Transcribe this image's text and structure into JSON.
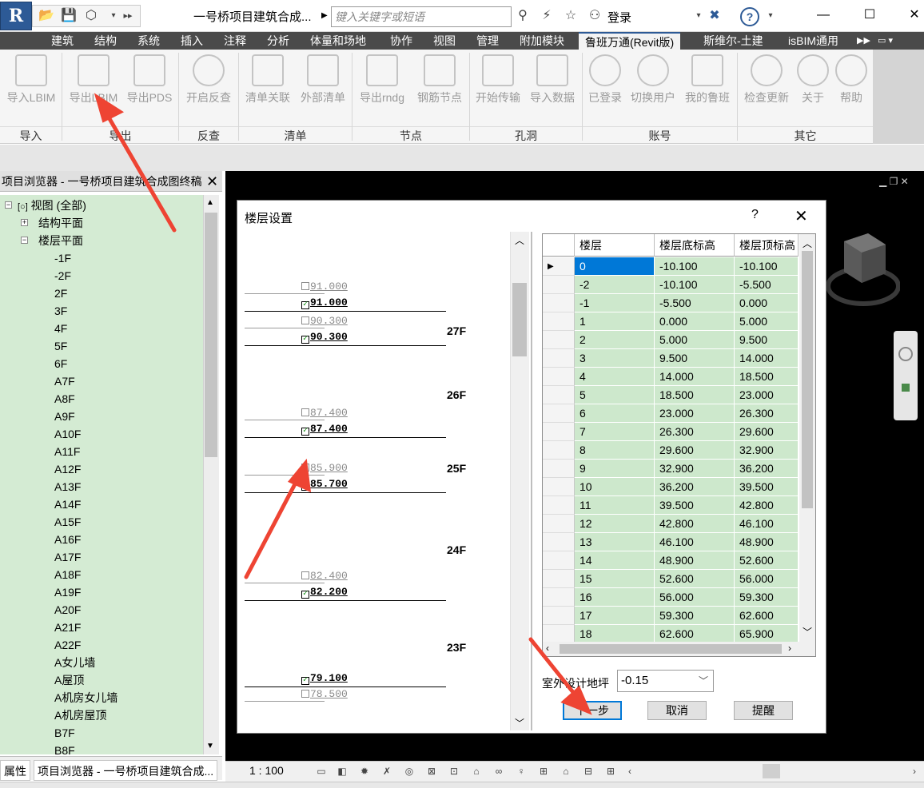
{
  "titlebar": {
    "app_glyph": "R",
    "document_title": "一号桥项目建筑合成...",
    "search_placeholder": "键入关键字或短语",
    "login_label": "登录",
    "help_glyph": "?",
    "minimize_glyph": "—",
    "maximize_glyph": "☐",
    "close_glyph": "✕"
  },
  "menu": {
    "items": [
      "建筑",
      "结构",
      "系统",
      "插入",
      "注释",
      "分析",
      "体量和场地",
      "协作",
      "视图",
      "管理",
      "附加模块",
      "鲁班万通(Revit版)",
      "斯维尔-土建",
      "isBIM通用"
    ],
    "active_index": 11
  },
  "ribbon": {
    "buttons": [
      "导入LBIM",
      "导出LBIM",
      "导出PDS",
      "开启反查",
      "清单关联",
      "外部清单",
      "导出rndg",
      "钢筋节点",
      "开始传输",
      "导入数据",
      "已登录",
      "切换用户",
      "我的鲁班",
      "检查更新",
      "关于",
      "帮助"
    ],
    "groups": [
      "导入",
      "导出",
      "反查",
      "清单",
      "节点",
      "孔洞",
      "账号",
      "其它"
    ]
  },
  "project_browser": {
    "title": "项目浏览器 - 一号桥项目建筑合成图终稿",
    "root": "视图 (全部)",
    "structural_plan": "结构平面",
    "floor_plan": "楼层平面",
    "floors": [
      "-1F",
      "-2F",
      "2F",
      "3F",
      "4F",
      "5F",
      "6F",
      "A7F",
      "A8F",
      "A9F",
      "A10F",
      "A11F",
      "A12F",
      "A13F",
      "A14F",
      "A15F",
      "A16F",
      "A17F",
      "A18F",
      "A19F",
      "A20F",
      "A21F",
      "A22F",
      "A女儿墙",
      "A屋顶",
      "A机房女儿墙",
      "A机房屋顶",
      "B7F",
      "B8F"
    ],
    "tabs": [
      "属性",
      "项目浏览器 - 一号桥项目建筑合成..."
    ]
  },
  "view": {
    "scale": "1 : 100"
  },
  "dialog": {
    "title": "楼层设置",
    "help": "?",
    "close": "✕",
    "elevations": [
      {
        "value": "91.000",
        "checked": false
      },
      {
        "value": "91.000",
        "checked": true
      },
      {
        "value": "90.300",
        "checked": false
      },
      {
        "value": "90.300",
        "checked": true
      },
      {
        "value": "87.400",
        "checked": false
      },
      {
        "value": "87.400",
        "checked": true
      },
      {
        "value": "85.900",
        "checked": false
      },
      {
        "value": "85.700",
        "checked": true
      },
      {
        "value": "82.400",
        "checked": false
      },
      {
        "value": "82.200",
        "checked": true
      },
      {
        "value": "79.100",
        "checked": true
      },
      {
        "value": "78.500",
        "checked": false
      }
    ],
    "floor_labels": [
      "27F",
      "26F",
      "25F",
      "24F",
      "23F"
    ],
    "grid": {
      "columns": [
        "楼层",
        "楼层底标高",
        "楼层顶标高"
      ],
      "rows": [
        [
          "0",
          "-10.100",
          "-10.100"
        ],
        [
          "-2",
          "-10.100",
          "-5.500"
        ],
        [
          "-1",
          "-5.500",
          "0.000"
        ],
        [
          "1",
          "0.000",
          "5.000"
        ],
        [
          "2",
          "5.000",
          "9.500"
        ],
        [
          "3",
          "9.500",
          "14.000"
        ],
        [
          "4",
          "14.000",
          "18.500"
        ],
        [
          "5",
          "18.500",
          "23.000"
        ],
        [
          "6",
          "23.000",
          "26.300"
        ],
        [
          "7",
          "26.300",
          "29.600"
        ],
        [
          "8",
          "29.600",
          "32.900"
        ],
        [
          "9",
          "32.900",
          "36.200"
        ],
        [
          "10",
          "36.200",
          "39.500"
        ],
        [
          "11",
          "39.500",
          "42.800"
        ],
        [
          "12",
          "42.800",
          "46.100"
        ],
        [
          "13",
          "46.100",
          "48.900"
        ],
        [
          "14",
          "48.900",
          "52.600"
        ],
        [
          "15",
          "52.600",
          "56.000"
        ],
        [
          "16",
          "56.000",
          "59.300"
        ],
        [
          "17",
          "59.300",
          "62.600"
        ],
        [
          "18",
          "62.600",
          "65.900"
        ]
      ]
    },
    "ground_label": "室外设计地坪",
    "ground_value": "-0.15",
    "btn_next": "下一步",
    "btn_cancel": "取消",
    "btn_remind": "提醒"
  },
  "colors": {
    "tree_bg": "#d4ebd3",
    "grid_cell": "#cde8cc",
    "annotation_arrow": "#ee4433",
    "menu_bg": "#4a4a4a"
  }
}
